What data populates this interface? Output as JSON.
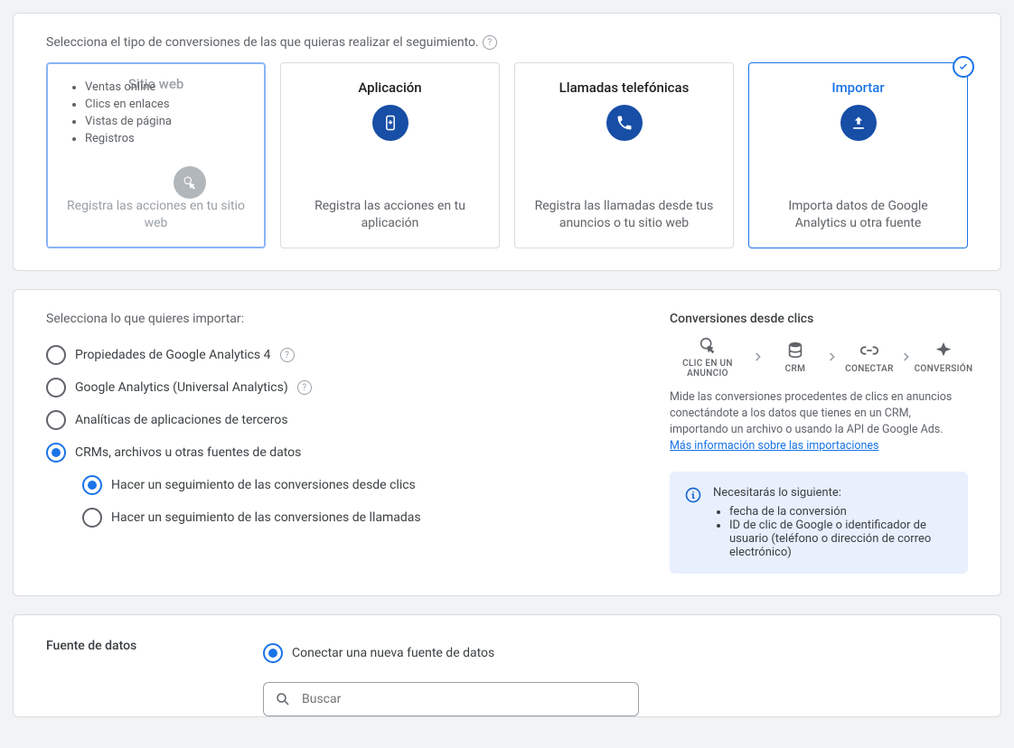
{
  "typePanel": {
    "prompt": "Selecciona el tipo de conversiones de las que quieras realizar el seguimiento.",
    "cards": [
      {
        "title": "Sitio web",
        "desc": "Registra las acciones en tu sitio web",
        "bullets": [
          "Ventas online",
          "Clics en enlaces",
          "Vistas de página",
          "Registros"
        ]
      },
      {
        "title": "Aplicación",
        "desc": "Registra las acciones en tu aplicación"
      },
      {
        "title": "Llamadas telefónicas",
        "desc": "Registra las llamadas desde tus anuncios o tu sitio web"
      },
      {
        "title": "Importar",
        "desc": "Importa datos de Google Analytics u otra fuente"
      }
    ]
  },
  "importPanel": {
    "heading": "Selecciona lo que quieres importar:",
    "options": [
      {
        "label": "Propiedades de Google Analytics 4",
        "help": true
      },
      {
        "label": "Google Analytics (Universal Analytics)",
        "help": true
      },
      {
        "label": "Analíticas de aplicaciones de terceros"
      },
      {
        "label": "CRMs, archivos u otras fuentes de datos"
      }
    ],
    "subOptions": [
      {
        "label": "Hacer un seguimiento de las conversiones desde clics"
      },
      {
        "label": "Hacer un seguimiento de las conversiones de llamadas"
      }
    ],
    "right": {
      "title": "Conversiones desde clics",
      "flow": [
        "CLIC EN UN ANUNCIO",
        "CRM",
        "CONECTAR",
        "CONVERSIÓN"
      ],
      "desc": "Mide las conversiones procedentes de clics en anuncios conectándote a los datos que tienes en un CRM, importando un archivo o usando la API de Google Ads.",
      "moreLink": "Más información sobre las importaciones",
      "needHeading": "Necesitarás lo siguiente:",
      "needs": [
        "fecha de la conversión",
        "ID de clic de Google o identificador de usuario (teléfono o dirección de correo electrónico)"
      ]
    }
  },
  "dataSource": {
    "label": "Fuente de datos",
    "option": "Conectar una nueva fuente de datos",
    "searchPlaceholder": "Buscar"
  }
}
